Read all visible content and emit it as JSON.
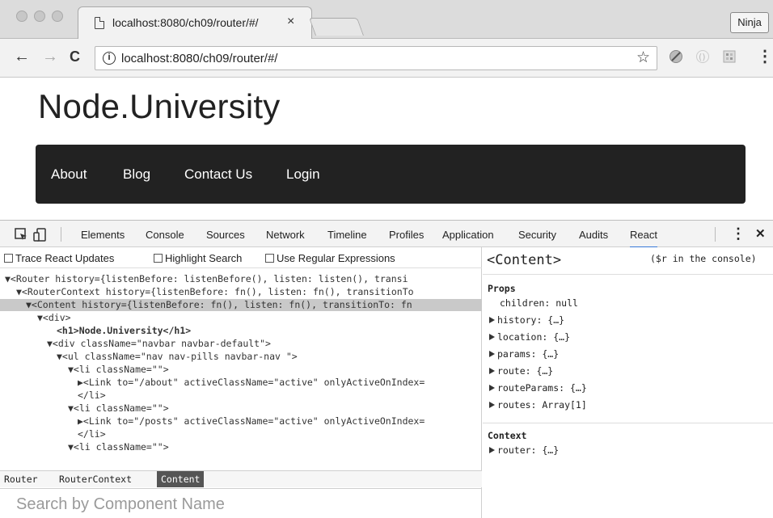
{
  "browser": {
    "tab_title": "localhost:8080/ch09/router/#/",
    "tab_close": "×",
    "profile_label": "Ninja",
    "back": "←",
    "forward": "→",
    "reload": "C",
    "info": "i",
    "url": "localhost:8080/ch09/router/#/",
    "bookmark": "☆",
    "menu": "⋮"
  },
  "page": {
    "title": "Node.University",
    "nav": [
      "About",
      "Blog",
      "Contact Us",
      "Login"
    ]
  },
  "devtools": {
    "tabs": [
      "Elements",
      "Console",
      "Sources",
      "Network",
      "Timeline",
      "Profiles",
      "Application",
      "Security",
      "Audits",
      "React"
    ],
    "active_tab": "React",
    "kebab": "⋮",
    "close": "✕",
    "options": [
      "Trace React Updates",
      "Highlight Search",
      "Use Regular Expressions"
    ],
    "tree": [
      "▼<Router history={listenBefore: listenBefore(), listen: listen(), transi",
      "▼<RouterContext history={listenBefore: fn(), listen: fn(), transitionTo",
      "▼<Content history={listenBefore: fn(), listen: fn(), transitionTo: fn",
      "▼<div>",
      "<h1>Node.University</h1>",
      "▼<div className=\"navbar navbar-default\">",
      "▼<ul className=\"nav nav-pills navbar-nav \">",
      "▼<li className=\"\">",
      "▶<Link to=\"/about\" activeClassName=\"active\" onlyActiveOnIndex=",
      "</li>",
      "▼<li className=\"\">",
      "▶<Link to=\"/posts\" activeClassName=\"active\" onlyActiveOnIndex=",
      "</li>",
      "▼<li className=\"\">"
    ],
    "breadcrumbs": [
      "Router",
      "RouterContext",
      "Content"
    ],
    "search_placeholder": "Search by Component Name",
    "side": {
      "component": "<Content>",
      "hint": "($r in the console)",
      "props_title": "Props",
      "props": [
        "children: null",
        "history: {…}",
        "location: {…}",
        "params: {…}",
        "route: {…}",
        "routeParams: {…}",
        "routes: Array[1]"
      ],
      "context_title": "Context",
      "context": [
        "router: {…}"
      ]
    }
  }
}
